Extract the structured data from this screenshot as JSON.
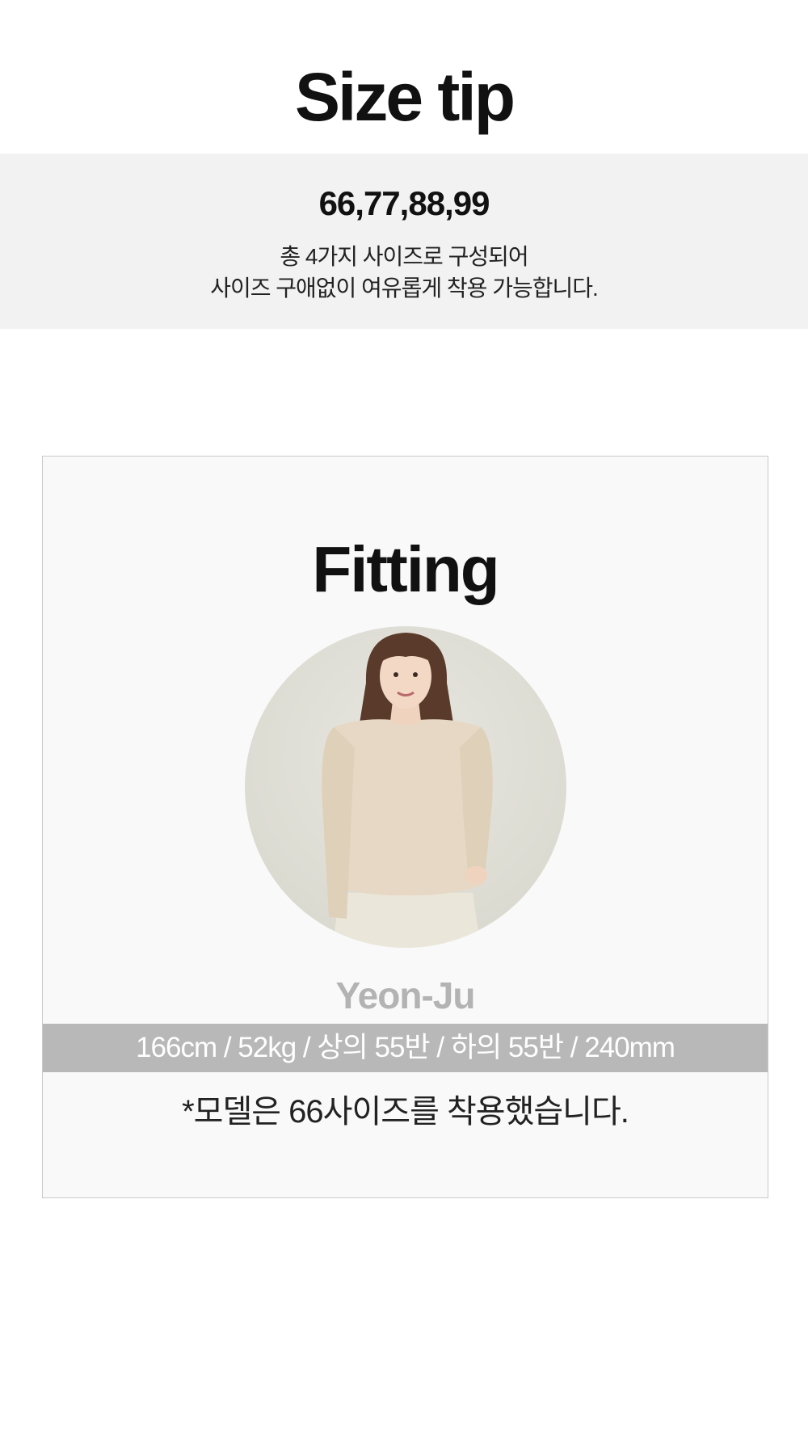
{
  "size_tip": {
    "title": "Size tip",
    "sizes": "66,77,88,99",
    "description_line1": "총 4가지 사이즈로 구성되어",
    "description_line2": "사이즈 구애없이 여유롭게 착용 가능합니다."
  },
  "fitting": {
    "title": "Fitting",
    "model_name": "Yeon-Ju",
    "model_specs": "166cm / 52kg / 상의 55반 / 하의 55반 / 240mm",
    "note": "*모델은 66사이즈를 착용했습니다."
  },
  "colors": {
    "size_box_bg": "#f2f2f2",
    "card_bg": "#f9f9f9",
    "spec_band_bg": "#b8b8b8",
    "model_name": "#b3b3b3"
  }
}
